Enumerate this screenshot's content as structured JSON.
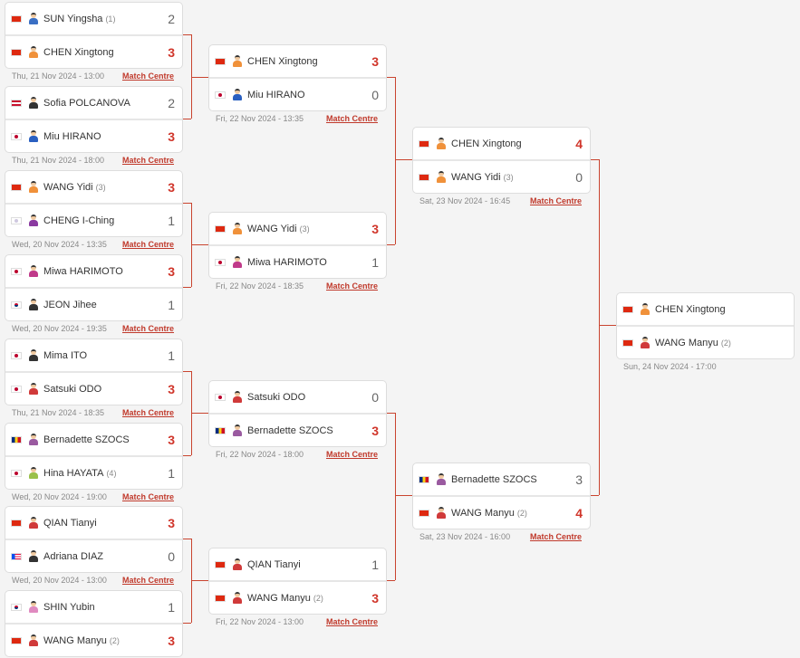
{
  "match_centre_label": "Match Centre",
  "flag_colors": {
    "CHN": "#de2910",
    "JPN": "#bc002d",
    "AUT": "#c8102e",
    "TPE": "#fff",
    "KOR": "#fff",
    "ROU": "#002b7f",
    "PUR": "#ed0a3f"
  },
  "rounds": [
    {
      "matches": [
        {
          "players": [
            {
              "flag": "CHN",
              "name": "SUN Yingsha",
              "seed": "(1)",
              "score": "2",
              "win": false,
              "shirt": "#3a6fc4"
            },
            {
              "flag": "CHN",
              "name": "CHEN Xingtong",
              "seed": "",
              "score": "3",
              "win": true,
              "shirt": "#f0913a"
            }
          ],
          "date": "Thu, 21 Nov 2024 - 13:00",
          "link": true
        },
        {
          "players": [
            {
              "flag": "AUT",
              "name": "Sofia POLCANOVA",
              "seed": "",
              "score": "2",
              "win": false,
              "shirt": "#333"
            },
            {
              "flag": "JPN",
              "name": "Miu HIRANO",
              "seed": "",
              "score": "3",
              "win": true,
              "shirt": "#2a5fc0"
            }
          ],
          "date": "Thu, 21 Nov 2024 - 18:00",
          "link": true
        },
        {
          "players": [
            {
              "flag": "CHN",
              "name": "WANG Yidi",
              "seed": "(3)",
              "score": "3",
              "win": true,
              "shirt": "#f0913a"
            },
            {
              "flag": "TPE",
              "name": "CHENG I-Ching",
              "seed": "",
              "score": "1",
              "win": false,
              "shirt": "#8a3aa0"
            }
          ],
          "date": "Wed, 20 Nov 2024 - 13:35",
          "link": true
        },
        {
          "players": [
            {
              "flag": "JPN",
              "name": "Miwa HARIMOTO",
              "seed": "",
              "score": "3",
              "win": true,
              "shirt": "#c03a8a"
            },
            {
              "flag": "KOR",
              "name": "JEON Jihee",
              "seed": "",
              "score": "1",
              "win": false,
              "shirt": "#333"
            }
          ],
          "date": "Wed, 20 Nov 2024 - 19:35",
          "link": true
        },
        {
          "players": [
            {
              "flag": "JPN",
              "name": "Mima ITO",
              "seed": "",
              "score": "1",
              "win": false,
              "shirt": "#333"
            },
            {
              "flag": "JPN",
              "name": "Satsuki ODO",
              "seed": "",
              "score": "3",
              "win": true,
              "shirt": "#d03a3a"
            }
          ],
          "date": "Thu, 21 Nov 2024 - 18:35",
          "link": true
        },
        {
          "players": [
            {
              "flag": "ROU",
              "name": "Bernadette SZOCS",
              "seed": "",
              "score": "3",
              "win": true,
              "shirt": "#9a5aa0"
            },
            {
              "flag": "JPN",
              "name": "Hina HAYATA",
              "seed": "(4)",
              "score": "1",
              "win": false,
              "shirt": "#9ac04a"
            }
          ],
          "date": "Wed, 20 Nov 2024 - 19:00",
          "link": true
        },
        {
          "players": [
            {
              "flag": "CHN",
              "name": "QIAN Tianyi",
              "seed": "",
              "score": "3",
              "win": true,
              "shirt": "#d03a3a"
            },
            {
              "flag": "PUR",
              "name": "Adriana DIAZ",
              "seed": "",
              "score": "0",
              "win": false,
              "shirt": "#333"
            }
          ],
          "date": "Wed, 20 Nov 2024 - 13:00",
          "link": true
        },
        {
          "players": [
            {
              "flag": "KOR",
              "name": "SHIN Yubin",
              "seed": "",
              "score": "1",
              "win": false,
              "shirt": "#e08ac0"
            },
            {
              "flag": "CHN",
              "name": "WANG Manyu",
              "seed": "(2)",
              "score": "3",
              "win": true,
              "shirt": "#d03a3a"
            }
          ],
          "date": "",
          "link": false
        }
      ]
    },
    {
      "matches": [
        {
          "players": [
            {
              "flag": "CHN",
              "name": "CHEN Xingtong",
              "seed": "",
              "score": "3",
              "win": true,
              "shirt": "#f0913a"
            },
            {
              "flag": "JPN",
              "name": "Miu HIRANO",
              "seed": "",
              "score": "0",
              "win": false,
              "shirt": "#2a5fc0"
            }
          ],
          "date": "Fri, 22 Nov 2024 - 13:35",
          "link": true
        },
        {
          "players": [
            {
              "flag": "CHN",
              "name": "WANG Yidi",
              "seed": "(3)",
              "score": "3",
              "win": true,
              "shirt": "#f0913a"
            },
            {
              "flag": "JPN",
              "name": "Miwa HARIMOTO",
              "seed": "",
              "score": "1",
              "win": false,
              "shirt": "#c03a8a"
            }
          ],
          "date": "Fri, 22 Nov 2024 - 18:35",
          "link": true
        },
        {
          "players": [
            {
              "flag": "JPN",
              "name": "Satsuki ODO",
              "seed": "",
              "score": "0",
              "win": false,
              "shirt": "#d03a3a"
            },
            {
              "flag": "ROU",
              "name": "Bernadette SZOCS",
              "seed": "",
              "score": "3",
              "win": true,
              "shirt": "#9a5aa0"
            }
          ],
          "date": "Fri, 22 Nov 2024 - 18:00",
          "link": true
        },
        {
          "players": [
            {
              "flag": "CHN",
              "name": "QIAN Tianyi",
              "seed": "",
              "score": "1",
              "win": false,
              "shirt": "#d03a3a"
            },
            {
              "flag": "CHN",
              "name": "WANG Manyu",
              "seed": "(2)",
              "score": "3",
              "win": true,
              "shirt": "#d03a3a"
            }
          ],
          "date": "Fri, 22 Nov 2024 - 13:00",
          "link": true
        }
      ]
    },
    {
      "matches": [
        {
          "players": [
            {
              "flag": "CHN",
              "name": "CHEN Xingtong",
              "seed": "",
              "score": "4",
              "win": true,
              "shirt": "#f0913a"
            },
            {
              "flag": "CHN",
              "name": "WANG Yidi",
              "seed": "(3)",
              "score": "0",
              "win": false,
              "shirt": "#f0913a"
            }
          ],
          "date": "Sat, 23 Nov 2024 - 16:45",
          "link": true
        },
        {
          "players": [
            {
              "flag": "ROU",
              "name": "Bernadette SZOCS",
              "seed": "",
              "score": "3",
              "win": false,
              "shirt": "#9a5aa0"
            },
            {
              "flag": "CHN",
              "name": "WANG Manyu",
              "seed": "(2)",
              "score": "4",
              "win": true,
              "shirt": "#d03a3a"
            }
          ],
          "date": "Sat, 23 Nov 2024 - 16:00",
          "link": true
        }
      ]
    },
    {
      "matches": [
        {
          "players": [
            {
              "flag": "CHN",
              "name": "CHEN Xingtong",
              "seed": "",
              "score": "",
              "win": false,
              "shirt": "#f0913a"
            },
            {
              "flag": "CHN",
              "name": "WANG Manyu",
              "seed": "(2)",
              "score": "",
              "win": false,
              "shirt": "#d03a3a"
            }
          ],
          "date": "Sun, 24 Nov 2024 - 17:00",
          "link": false
        }
      ]
    }
  ]
}
